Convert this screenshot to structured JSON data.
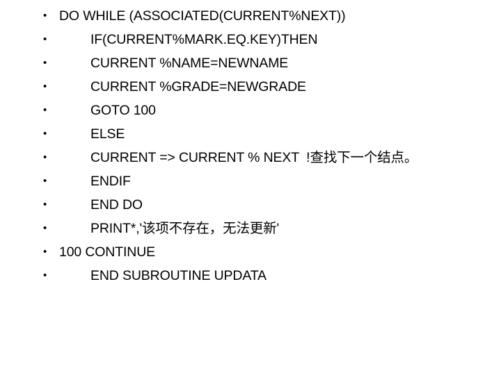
{
  "slide": {
    "background_color": "#ffffff",
    "text_color": "#000000",
    "bullet_glyph": "•",
    "lines": [
      {
        "indent": 0,
        "text": "DO WHILE (ASSOCIATED(CURRENT%NEXT))"
      },
      {
        "indent": 1,
        "text": "IF(CURRENT%MARK.EQ.KEY)THEN"
      },
      {
        "indent": 1,
        "text": "CURRENT %NAME=NEWNAME"
      },
      {
        "indent": 1,
        "text": "CURRENT %GRADE=NEWGRADE"
      },
      {
        "indent": 1,
        "text": "GOTO 100"
      },
      {
        "indent": 1,
        "text": "ELSE"
      },
      {
        "indent": 1,
        "text": "CURRENT => CURRENT % NEXT  !查找下一个结点。"
      },
      {
        "indent": 1,
        "text": "ENDIF"
      },
      {
        "indent": 1,
        "text": "END DO"
      },
      {
        "indent": 1,
        "text": "PRINT*,'该项不存在，无法更新'"
      },
      {
        "indent": 0,
        "text": "100 CONTINUE"
      },
      {
        "indent": 1,
        "text": "END SUBROUTINE UPDATA"
      }
    ]
  }
}
